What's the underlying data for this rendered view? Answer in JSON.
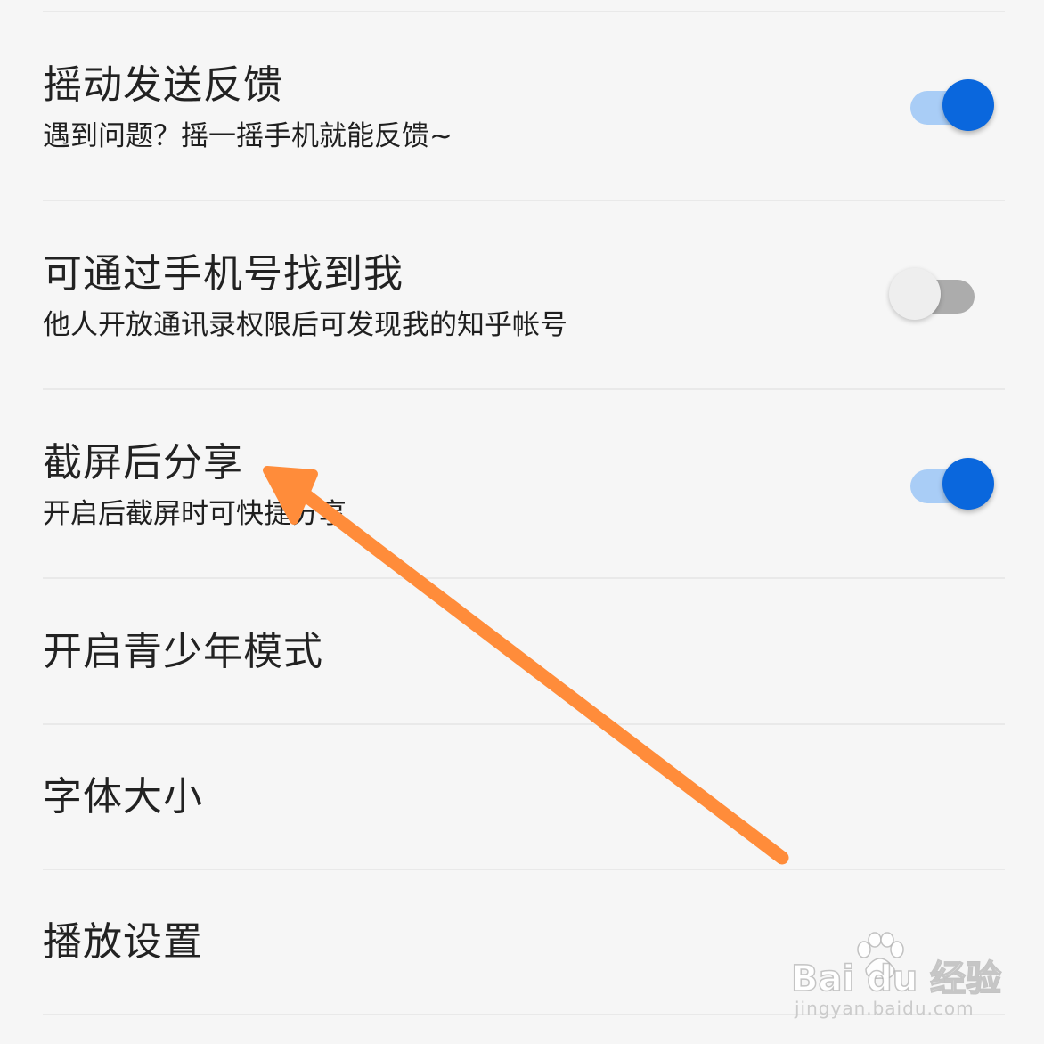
{
  "settings": [
    {
      "title": "摇动发送反馈",
      "subtitle": "遇到问题？摇一摇手机就能反馈~",
      "toggle": "on"
    },
    {
      "title": "可通过手机号找到我",
      "subtitle": "他人开放通讯录权限后可发现我的知乎帐号",
      "toggle": "off"
    },
    {
      "title": "截屏后分享",
      "subtitle": "开启后截屏时可快捷分享",
      "toggle": "on"
    },
    {
      "title": "开启青少年模式"
    },
    {
      "title": "字体大小"
    },
    {
      "title": "播放设置"
    }
  ],
  "colors": {
    "toggle_on_knob": "#0a67dd",
    "toggle_on_track": "#a9cdf6",
    "toggle_off_knob": "#eeeeee",
    "toggle_off_track": "#acacac",
    "annotation_arrow": "#ff8c3a"
  },
  "annotation": {
    "icon": "arrow-icon",
    "points_to": "截屏后分享"
  },
  "watermark": {
    "logo": "Bai du 经验",
    "url": "jingyan.baidu.com"
  }
}
